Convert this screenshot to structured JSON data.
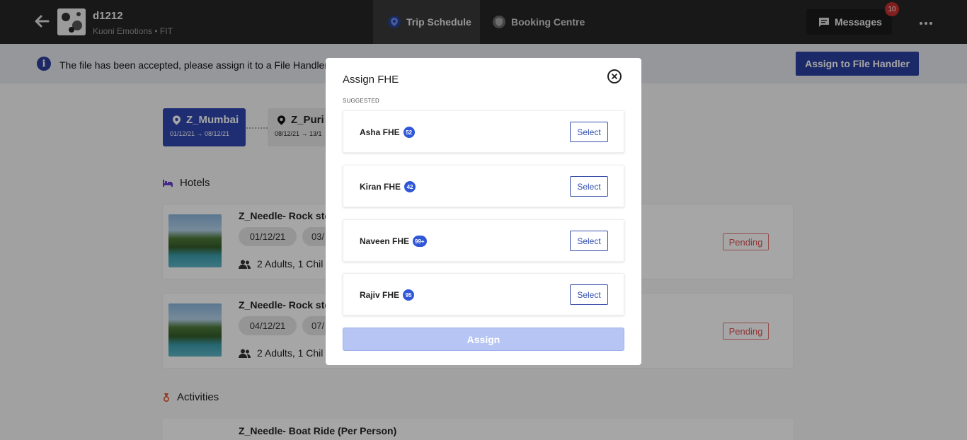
{
  "header": {
    "trip_id": "d1212",
    "subtitle": "Kuoni Emotions • FIT",
    "tabs": [
      {
        "label": "Trip Schedule",
        "icon": "location-pin-icon"
      },
      {
        "label": "Booking Centre",
        "icon": "shield-icon"
      }
    ],
    "messages_label": "Messages",
    "messages_count": "10"
  },
  "notice": {
    "text": "The file has been accepted, please assign it to a File Handler",
    "button": "Assign to File Handler"
  },
  "cities": [
    {
      "name": "Z_Mumbai",
      "dates": "01/12/21 → 08/12/21"
    },
    {
      "name": "Z_Puri",
      "dates": "08/12/21 → 13/1"
    }
  ],
  "sections": {
    "hotels": "Hotels",
    "activities": "Activities"
  },
  "hotels": [
    {
      "title": "Z_Needle- Rock sto",
      "date1": "01/12/21",
      "date2": "03/",
      "guests": "2 Adults, 1 Chil",
      "status": "Pending"
    },
    {
      "title": "Z_Needle- Rock sto",
      "date1": "04/12/21",
      "date2": "07/",
      "guests": "2 Adults, 1 Chil",
      "status": "Pending"
    }
  ],
  "activity": {
    "title": "Z_Needle- Boat Ride (Per Person)"
  },
  "modal": {
    "title": "Assign FHE",
    "suggested_label": "SUGGESTED",
    "options": [
      {
        "name": "Asha FHE",
        "count": "52",
        "select": "Select"
      },
      {
        "name": "Kiran FHE",
        "count": "42",
        "select": "Select"
      },
      {
        "name": "Naveen FHE",
        "count": "99+",
        "select": "Select"
      },
      {
        "name": "Rajiv FHE",
        "count": "95",
        "select": "Select"
      }
    ],
    "assign_label": "Assign"
  },
  "colors": {
    "topbar": "#262626",
    "brand_blue": "#2b3fa0",
    "count_badge": "#2f57d8",
    "pending": "#e05050",
    "assign_disabled": "#b7c5f4"
  }
}
